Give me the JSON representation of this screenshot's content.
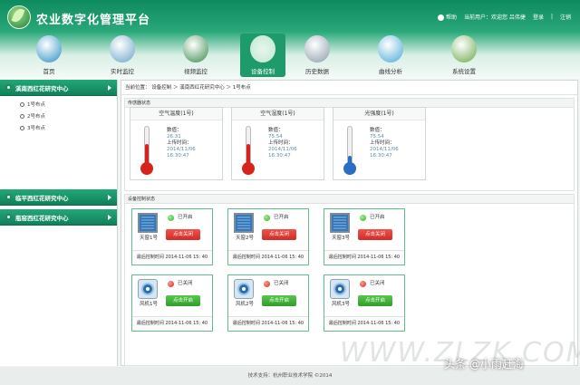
{
  "app": {
    "title": "农业数字化管理平台"
  },
  "topbar": {
    "help": "帮助",
    "current_user": "当前用户：欢迎您 吕伟捷",
    "login": "登录",
    "logout": "注销"
  },
  "nav": [
    {
      "label": "首页",
      "icon": "globe-icon"
    },
    {
      "label": "实时监控",
      "icon": "satellite-icon"
    },
    {
      "label": "视频监控",
      "icon": "monitor-icon"
    },
    {
      "label": "设备控制",
      "icon": "device-icon",
      "active": true
    },
    {
      "label": "历史数据",
      "icon": "database-icon"
    },
    {
      "label": "曲线分析",
      "icon": "chart-icon"
    },
    {
      "label": "系统设置",
      "icon": "settings-icon"
    }
  ],
  "sidebar": {
    "groups": [
      {
        "label": "溪南西红花研究中心",
        "items": [
          "1号布点",
          "2号布点",
          "3号布点"
        ]
      },
      {
        "label": "临平西红花研究中心"
      },
      {
        "label": "瓶窑西红花研究中心"
      }
    ]
  },
  "breadcrumb": {
    "text": "当前位置： 设备控制 ＞ 溪南西红花研究中心 ＞ 1号布点"
  },
  "sensors": {
    "title": "传感器状态",
    "value_label": "数值：",
    "time_label": "上传时间：",
    "items": [
      {
        "name": "空气温度(1号)",
        "value": "26.31",
        "date": "2014/11/06",
        "time": "16:30:47",
        "icon": "thermometer-icon",
        "kind": "temp"
      },
      {
        "name": "空气湿度(1号)",
        "value": "75.54",
        "date": "2014/11/06",
        "time": "16:30:47",
        "icon": "thermometer-icon",
        "kind": "temp"
      },
      {
        "name": "光强度(1号)",
        "value": "75.54",
        "date": "2014/11/06",
        "time": "16:30:47",
        "icon": "sun-icon",
        "kind": "light"
      }
    ]
  },
  "controls": {
    "title": "设备控制状态",
    "time_prefix": "最后控制时间",
    "items": [
      {
        "name": "天窗1号",
        "state": "已开启",
        "button": "点击关闭",
        "time": "2014-11-06 15: 40",
        "type": "blind",
        "on": true
      },
      {
        "name": "天窗2号",
        "state": "已开启",
        "button": "点击关闭",
        "time": "2014-11-06 15: 40",
        "type": "blind",
        "on": true
      },
      {
        "name": "天窗3号",
        "state": "已开启",
        "button": "点击关闭",
        "time": "2014-11-06 15: 40",
        "type": "blind",
        "on": true
      },
      {
        "name": "风机1号",
        "state": "已关闭",
        "button": "点击开启",
        "time": "2014-11-06 15: 40",
        "type": "fan",
        "on": false
      },
      {
        "name": "风机2号",
        "state": "已关闭",
        "button": "点击开启",
        "time": "2014-11-06 15: 40",
        "type": "fan",
        "on": false
      },
      {
        "name": "风机3号",
        "state": "已关闭",
        "button": "点击开启",
        "time": "2014-11-06 15: 40",
        "type": "fan",
        "on": false
      }
    ]
  },
  "footer": {
    "text": "技术支持：杭州职业技术学院 ©2014"
  },
  "watermark": {
    "text": "WWW.ZLZK.COM"
  },
  "credit": {
    "text": "头条 @小雨赶海"
  },
  "colors": {
    "brand": "#1f9a6a",
    "on": "#2fae36",
    "off": "#d12b24"
  }
}
